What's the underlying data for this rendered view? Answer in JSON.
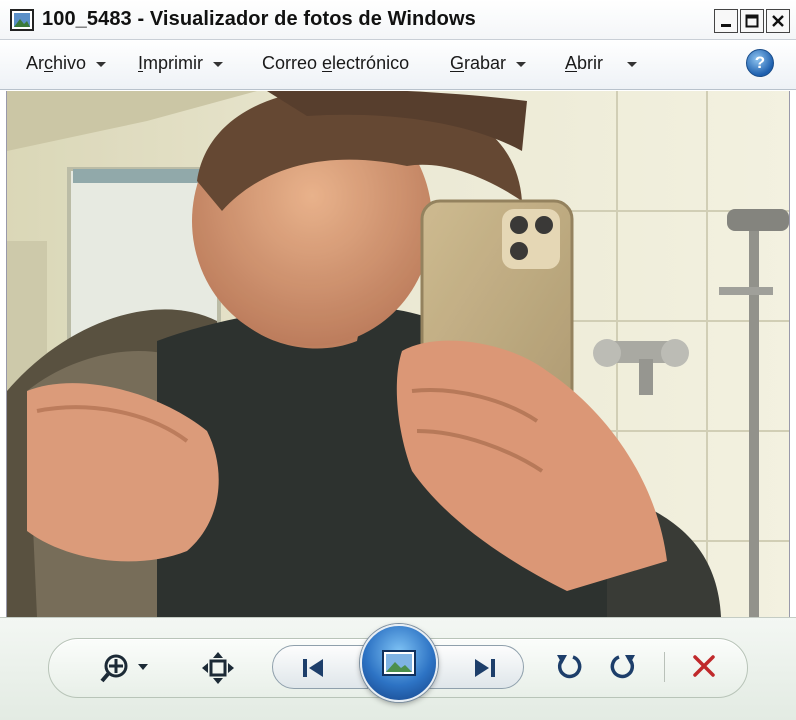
{
  "window": {
    "title": "100_5483 - Visualizador de fotos de Windows"
  },
  "menu": {
    "archivo": {
      "label_pre": "Ar",
      "mnemonic": "c",
      "label_post": "hivo"
    },
    "imprimir": {
      "mnemonic": "I",
      "label_post": "mprimir"
    },
    "correo": {
      "label_pre": "Correo ",
      "mnemonic": "e",
      "label_post": "lectrónico"
    },
    "grabar": {
      "mnemonic": "G",
      "label_post": "rabar"
    },
    "abrir": {
      "mnemonic": "A",
      "label_post": "brir"
    }
  },
  "icons": {
    "app": "photo-viewer-icon",
    "help": "help-icon",
    "zoom": "magnifier-plus-icon",
    "actual_size": "actual-size-icon",
    "previous": "previous-icon",
    "slideshow": "slideshow-icon",
    "next": "next-icon",
    "rotate_left": "rotate-counterclockwise-icon",
    "rotate_right": "rotate-clockwise-icon",
    "delete": "delete-icon"
  },
  "help_glyph": "?",
  "colors": {
    "accent_blue": "#2d73c4",
    "delete_red": "#c0292b"
  }
}
